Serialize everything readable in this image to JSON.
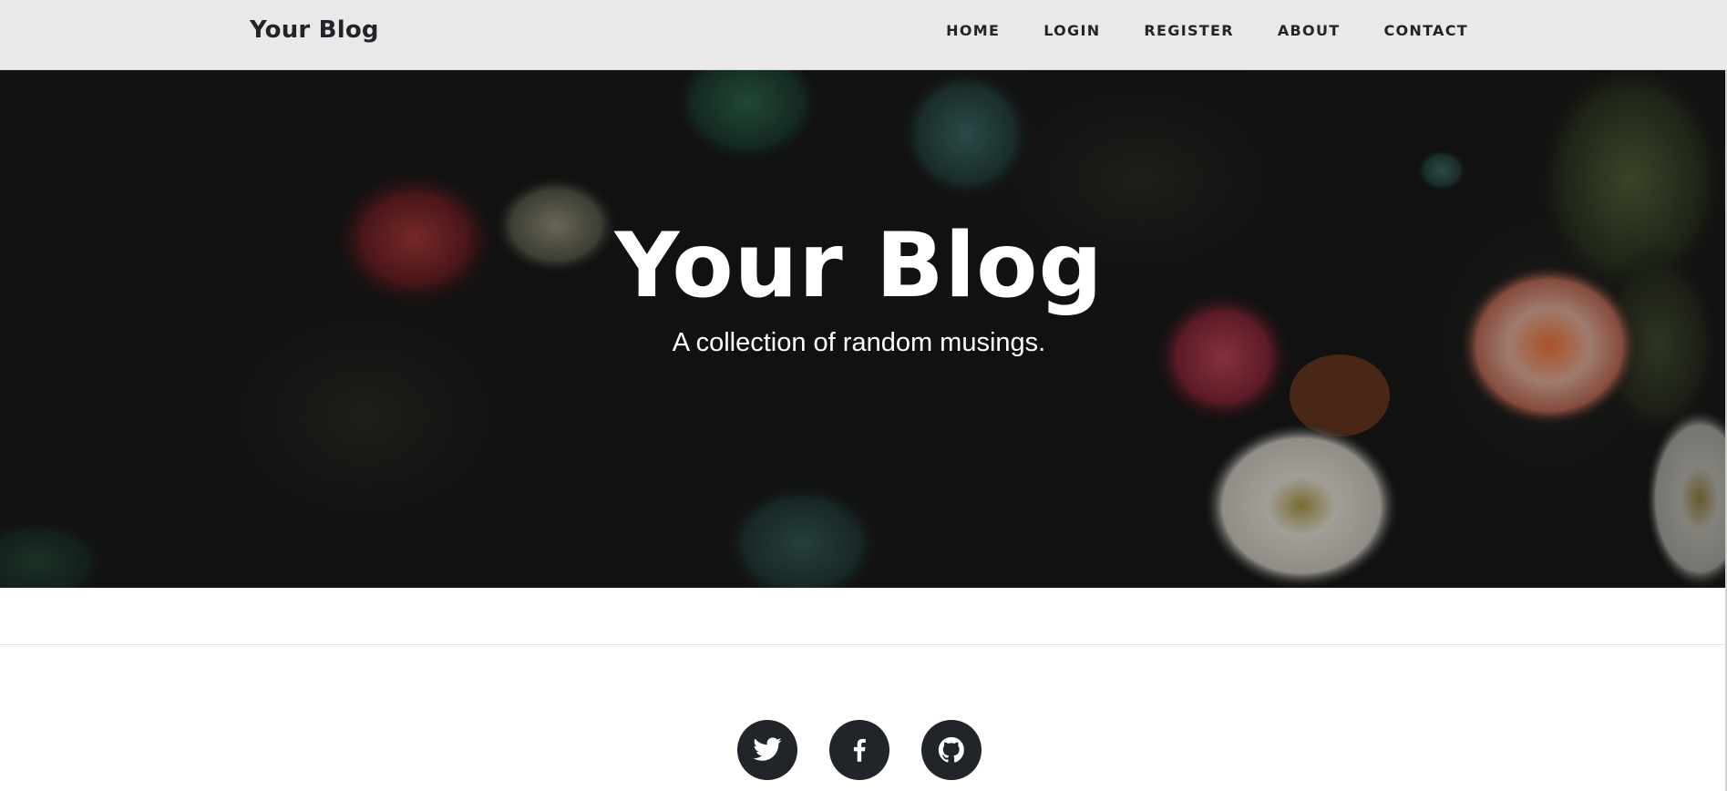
{
  "navbar": {
    "brand": "Your Blog",
    "links": [
      {
        "label": "HOME"
      },
      {
        "label": "LOGIN"
      },
      {
        "label": "REGISTER"
      },
      {
        "label": "ABOUT"
      },
      {
        "label": "CONTACT"
      }
    ],
    "background": "#e9e9e9",
    "text_color": "#212529"
  },
  "hero": {
    "title": "Your Blog",
    "subtitle": "A collection of random musings.",
    "background": "dark-sea-anemones-photo"
  },
  "social": {
    "icons": [
      "twitter-icon",
      "facebook-icon",
      "github-icon"
    ],
    "button_color": "#212529"
  }
}
